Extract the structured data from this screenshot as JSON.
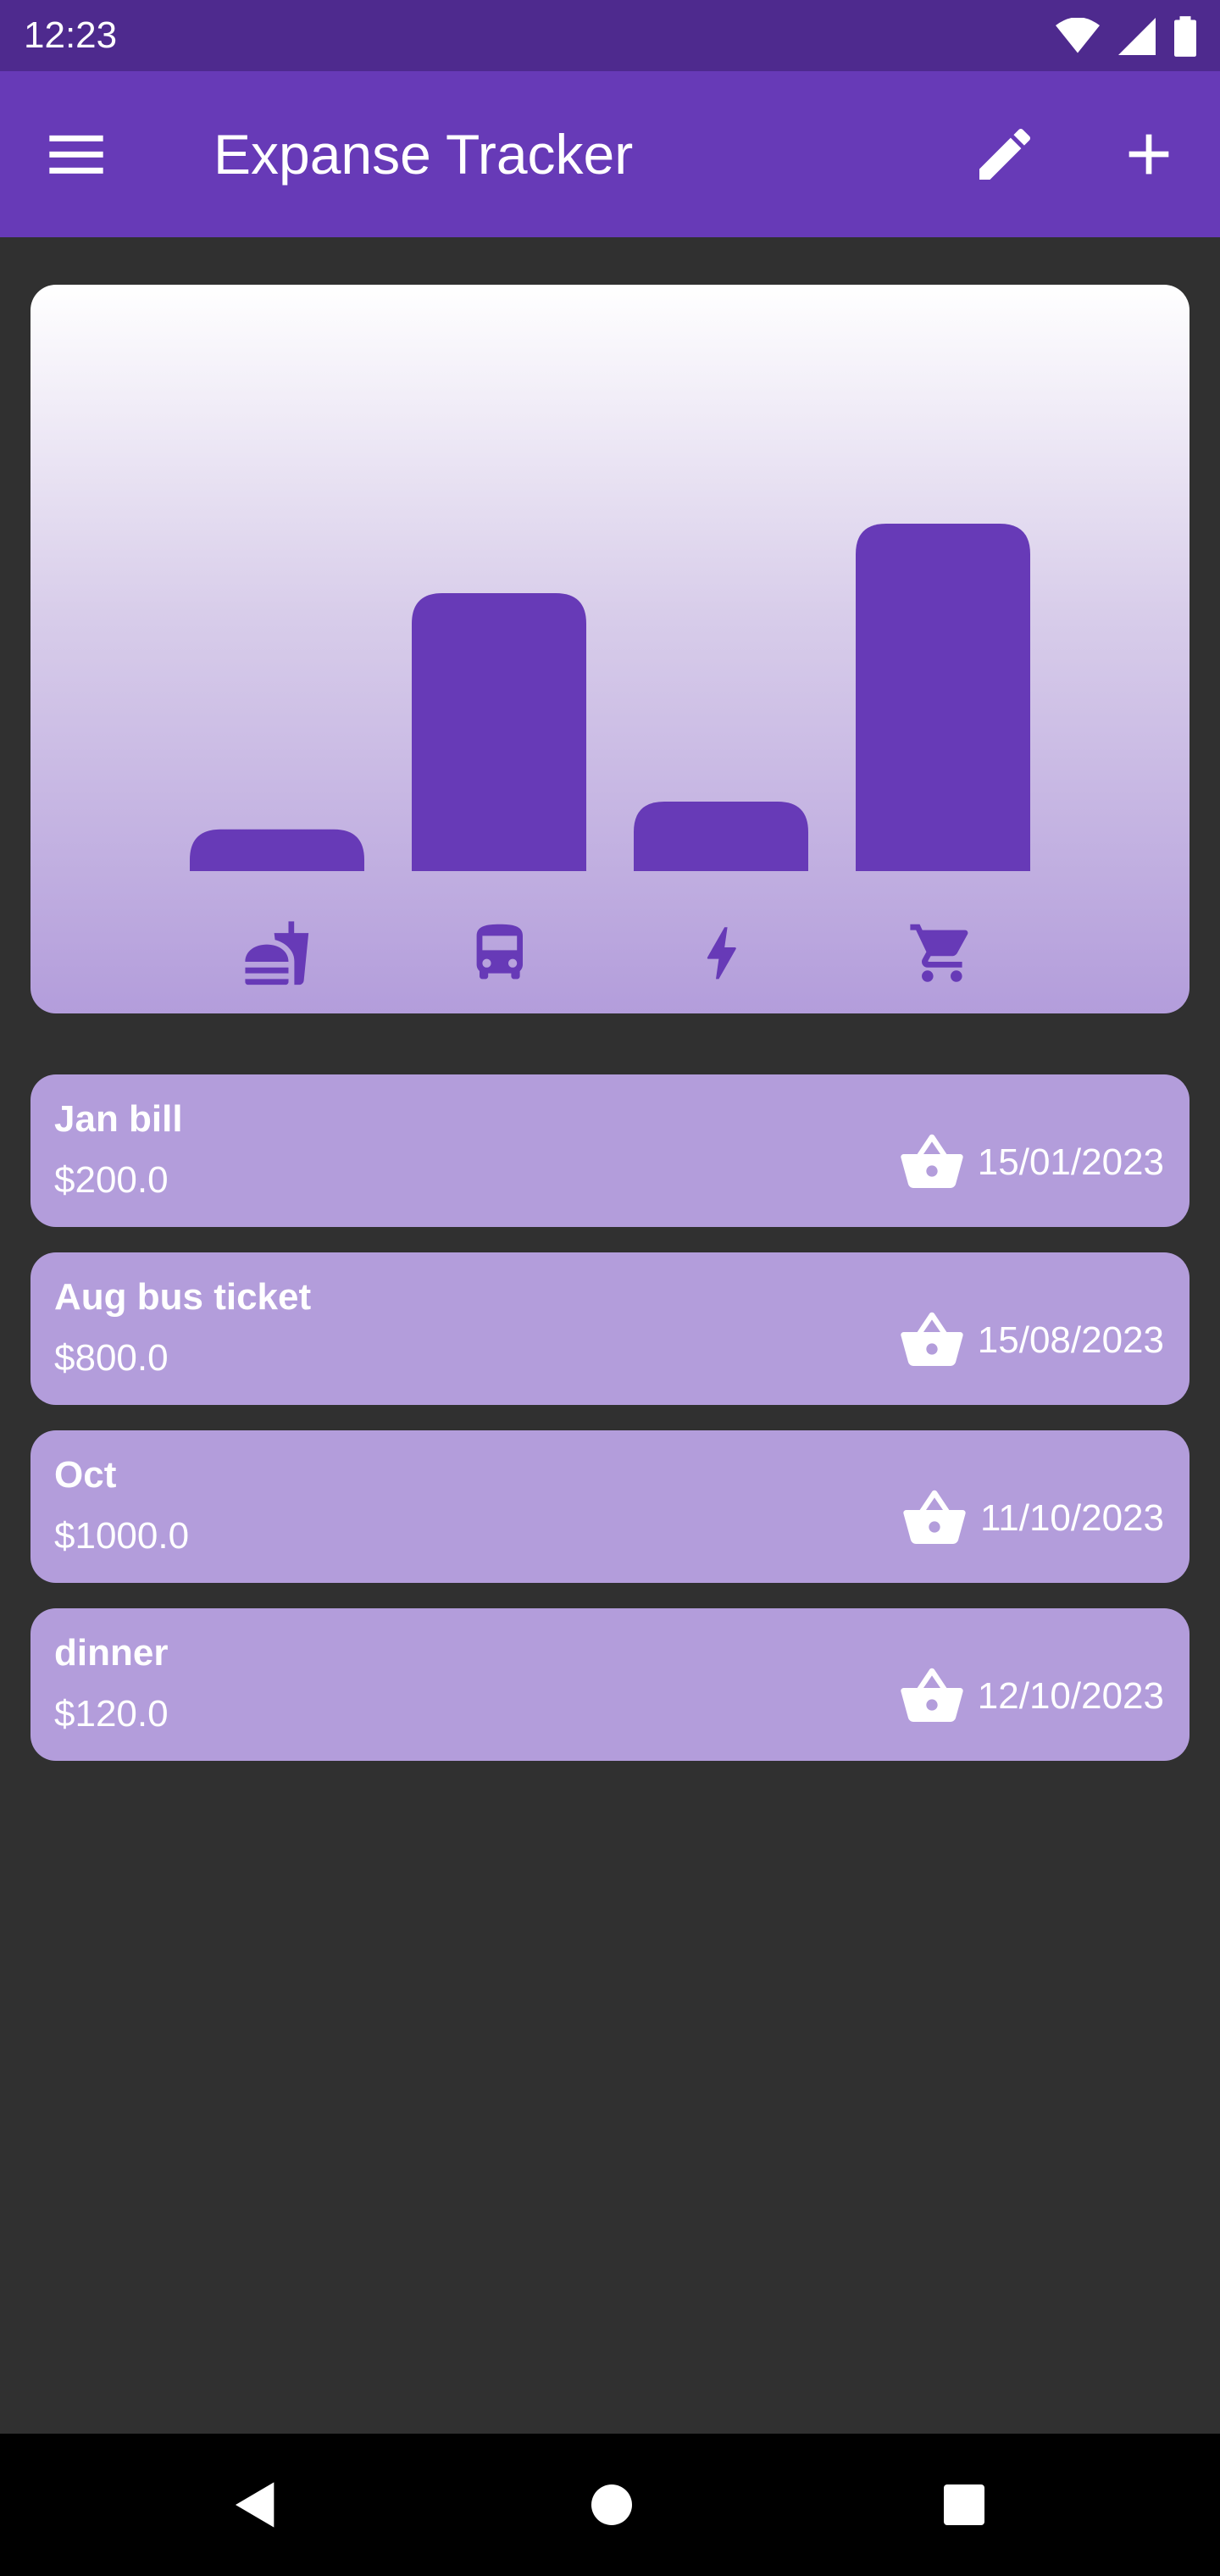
{
  "status_bar": {
    "time": "12:23",
    "icons": [
      "wifi-icon",
      "signal-icon",
      "battery-icon"
    ]
  },
  "app_bar": {
    "title": "Expanse Tracker",
    "icons": [
      "menu-icon",
      "edit-icon",
      "add-icon"
    ],
    "color": "#673ab7"
  },
  "chart_data": {
    "type": "bar",
    "categories": [
      "food",
      "travel",
      "bills",
      "shopping"
    ],
    "category_icons": [
      "fastfood-icon",
      "bus-icon",
      "bolt-icon",
      "cart-icon"
    ],
    "values": [
      0.12,
      0.8,
      0.2,
      1.0
    ],
    "bar_color": "#673ab7",
    "grid": false,
    "legend": "none"
  },
  "expenses": [
    {
      "title": "Jan bill",
      "amount": "$200.0",
      "date": "15/01/2023",
      "icon": "basket-icon"
    },
    {
      "title": "Aug bus ticket",
      "amount": "$800.0",
      "date": "15/08/2023",
      "icon": "basket-icon"
    },
    {
      "title": "Oct",
      "amount": "$1000.0",
      "date": "11/10/2023",
      "icon": "basket-icon"
    },
    {
      "title": "dinner",
      "amount": "$120.0",
      "date": "12/10/2023",
      "icon": "basket-icon"
    }
  ],
  "nav_bar": {
    "icons": [
      "back-icon",
      "home-icon",
      "recents-icon"
    ]
  },
  "colors": {
    "background": "#303030",
    "card": "#b39ddb",
    "status_bar": "#4e2a8e"
  }
}
